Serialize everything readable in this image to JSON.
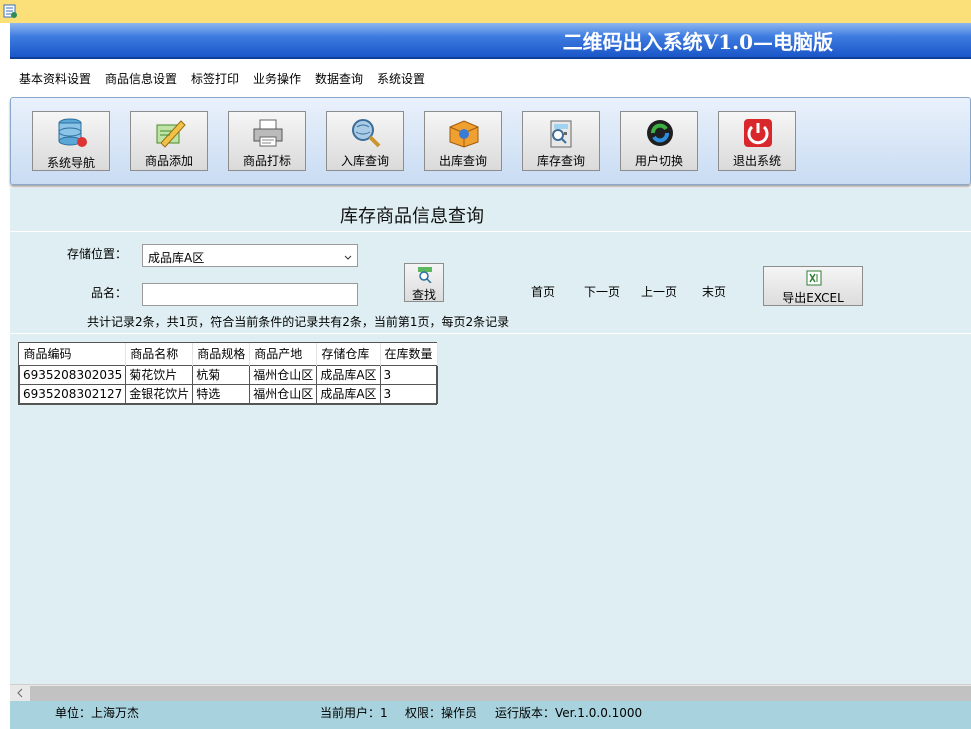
{
  "banner": {
    "title": "二维码出入系统V1.0—电脑版"
  },
  "menu": [
    {
      "label": "基本资料设置"
    },
    {
      "label": "商品信息设置"
    },
    {
      "label": "标签打印"
    },
    {
      "label": "业务操作"
    },
    {
      "label": "数据查询"
    },
    {
      "label": "系统设置"
    }
  ],
  "toolbar": [
    {
      "label": "系统导航",
      "icon": "database-icon"
    },
    {
      "label": "商品添加",
      "icon": "edit-pencil-icon"
    },
    {
      "label": "商品打标",
      "icon": "printer-icon"
    },
    {
      "label": "入库查询",
      "icon": "magnifier-globe-icon"
    },
    {
      "label": "出库查询",
      "icon": "box-icon"
    },
    {
      "label": "库存查询",
      "icon": "calculator-search-icon"
    },
    {
      "label": "用户切换",
      "icon": "switch-user-icon"
    },
    {
      "label": "退出系统",
      "icon": "power-icon"
    }
  ],
  "page": {
    "title": "库存商品信息查询",
    "location_label": "存储位置：",
    "location_value": "成品库A区",
    "name_label": "品名：",
    "name_value": "",
    "find_label": "查找",
    "pager": {
      "first": "首页",
      "next": "下一页",
      "prev": "上一页",
      "last": "末页"
    },
    "export_label": "导出EXCEL",
    "summary": "共计记录2条，共1页，符合当前条件的记录共有2条，当前第1页，每页2条记录"
  },
  "grid": {
    "columns": [
      "商品编码",
      "商品名称",
      "商品规格",
      "商品产地",
      "存储仓库",
      "在库数量"
    ],
    "rows": [
      [
        "6935208302035",
        "菊花饮片",
        "杭菊",
        "福州仓山区",
        "成品库A区",
        "3"
      ],
      [
        "6935208302127",
        "金银花饮片",
        "特选",
        "福州仓山区",
        "成品库A区",
        "3"
      ]
    ]
  },
  "status": {
    "unit": "单位：上海万杰",
    "current_user": "当前用户：1",
    "permission": "权限：操作员",
    "version": "运行版本：Ver.1.0.0.1000"
  },
  "colors": {
    "banner": "#1a56c8",
    "titlebar": "#fbe07a",
    "content_bg": "#dfeef2",
    "statusbar": "#a8d3de"
  }
}
